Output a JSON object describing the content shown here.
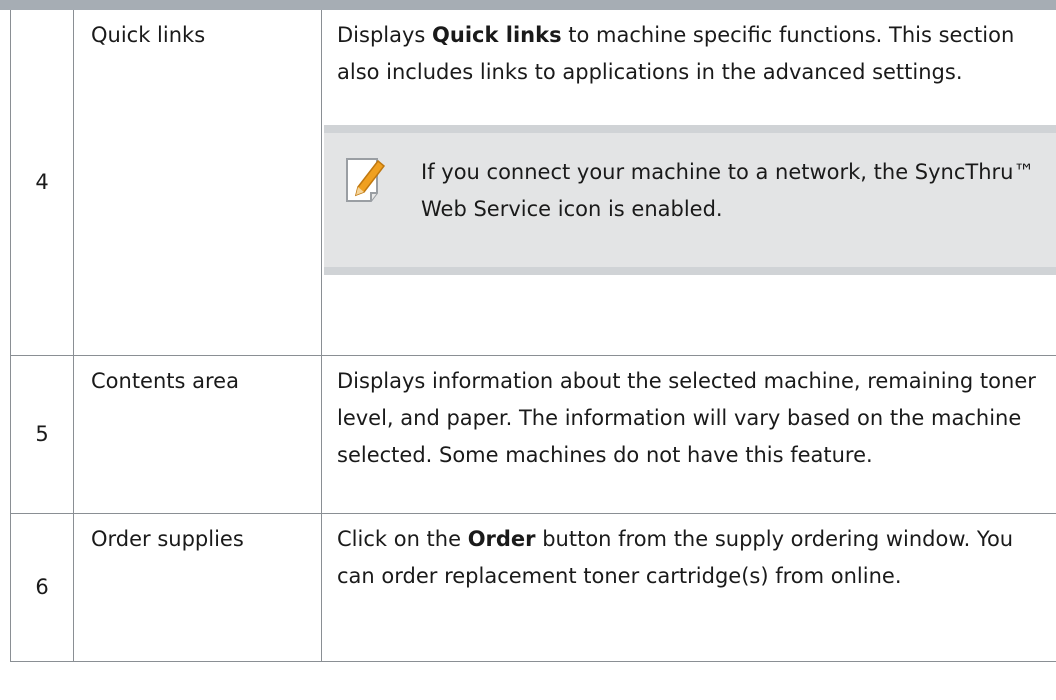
{
  "rows": [
    {
      "number": "4",
      "name": "Quick links",
      "desc_pre": "Displays ",
      "desc_bold": "Quick links",
      "desc_post": " to machine specific functions. This section also includes links to applications in the advanced settings.",
      "note": {
        "icon": "note-pencil-icon",
        "text": "If you connect your machine to a network, the SyncThru™ Web Service icon is enabled."
      }
    },
    {
      "number": "5",
      "name": "Contents area",
      "desc": "Displays information about the selected machine, remaining toner level, and paper. The information will vary based on the machine selected. Some machines do not have this feature."
    },
    {
      "number": "6",
      "name": "Order supplies",
      "desc_pre": "Click on the ",
      "desc_bold": "Order",
      "desc_post": " button from the supply ordering window. You can order replacement toner cartridge(s) from online."
    }
  ],
  "colors": {
    "top_rule": "#a6adb4",
    "note_background": "#e3e4e5",
    "note_border": "#d0d3d6",
    "icon_accent": "#f0a020"
  }
}
